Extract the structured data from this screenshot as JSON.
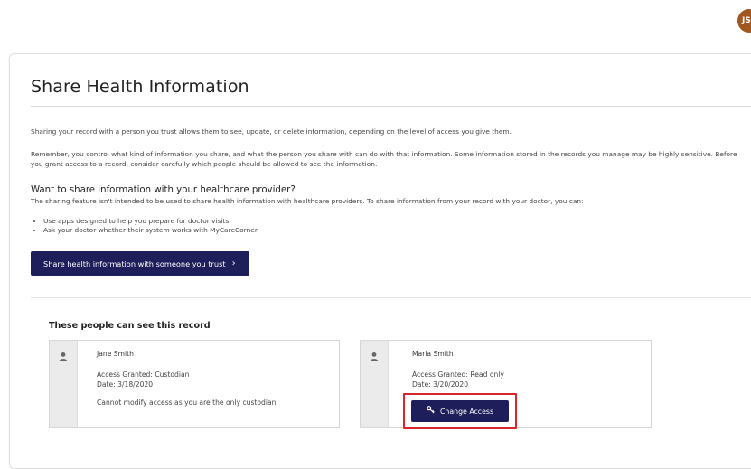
{
  "header": {
    "avatar_initials": "JS"
  },
  "page": {
    "title": "Share Health Information",
    "intro": "Sharing your record with a person you trust allows them to see, update, or delete information, depending on the level of access you give them.",
    "reminder": "Remember, you control what kind of information you share, and what the person you share with can do with that information. Some information stored in the records you manage may be highly sensitive. Before you grant access to a record, consider carefully which people should be allowed to see the information.",
    "provider_heading": "Want to share information with your healthcare provider?",
    "provider_text": "The sharing feature isn't intended to be used to share health information with healthcare providers. To share information from your record with your doctor, you can:",
    "bullets": [
      "Use apps designed to help you prepare for doctor visits.",
      "Ask your doctor whether their system works with MyCareCorner."
    ],
    "share_button_label": "Share health information with someone you trust",
    "share_button_chevron": "›"
  },
  "people": {
    "heading": "These people can see this record",
    "cards": [
      {
        "name": "Jane Smith",
        "access": "Access Granted: Custodian",
        "date": "Date: 3/18/2020",
        "note": "Cannot modify access as you are the only custodian."
      },
      {
        "name": "Maria Smith",
        "access": "Access Granted: Read only",
        "date": "Date: 3/20/2020",
        "button_label": "Change Access",
        "button_icon": "🔑"
      }
    ]
  },
  "colors": {
    "primary_button": "#1e1e5a",
    "avatar": "#a0561f",
    "highlight": "#d7262e"
  }
}
